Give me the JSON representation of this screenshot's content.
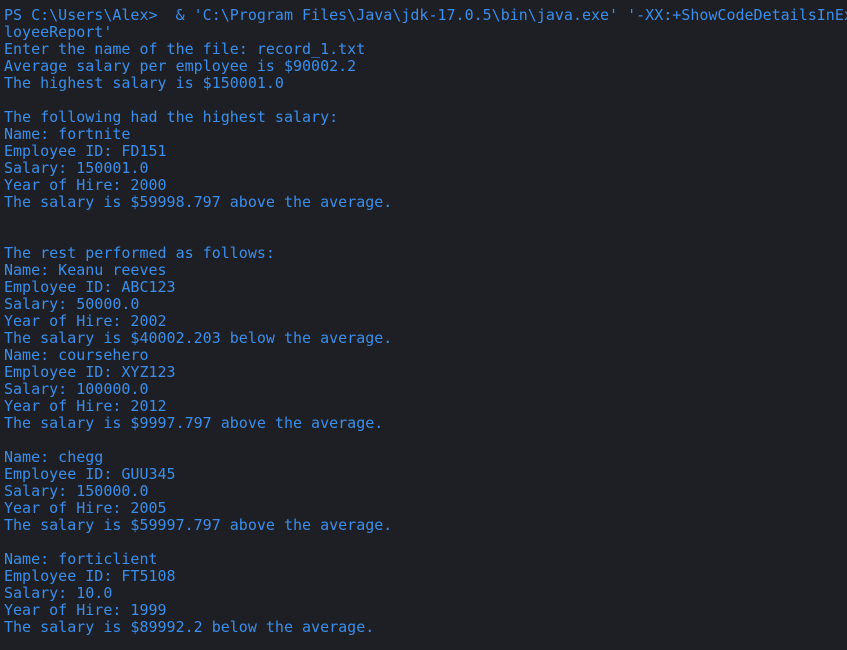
{
  "terminal": {
    "text_color": "#3b8eea",
    "background": "#1e1f24",
    "lines": [
      "PS C:\\Users\\Alex>  & 'C:\\Program Files\\Java\\jdk-17.0.5\\bin\\java.exe' '-XX:+ShowCodeDetailsInEx",
      "loyeeReport'",
      "Enter the name of the file: record_1.txt",
      "Average salary per employee is $90002.2",
      "The highest salary is $150001.0",
      "",
      "The following had the highest salary:",
      "Name: fortnite",
      "Employee ID: FD151",
      "Salary: 150001.0",
      "Year of Hire: 2000",
      "The salary is $59998.797 above the average.",
      "",
      "",
      "The rest performed as follows:",
      "Name: Keanu reeves",
      "Employee ID: ABC123",
      "Salary: 50000.0",
      "Year of Hire: 2002",
      "The salary is $40002.203 below the average.",
      "Name: coursehero",
      "Employee ID: XYZ123",
      "Salary: 100000.0",
      "Year of Hire: 2012",
      "The salary is $9997.797 above the average.",
      "",
      "Name: chegg",
      "Employee ID: GUU345",
      "Salary: 150000.0",
      "Year of Hire: 2005",
      "The salary is $59997.797 above the average.",
      "",
      "Name: forticlient",
      "Employee ID: FT5108",
      "Salary: 10.0",
      "Year of Hire: 1999",
      "The salary is $89992.2 below the average."
    ]
  }
}
